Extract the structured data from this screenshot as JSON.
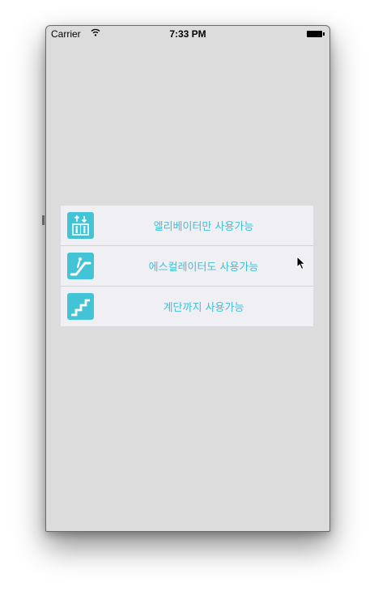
{
  "status_bar": {
    "carrier": "Carrier",
    "time": "7:33 PM",
    "wifi_icon": "wifi-icon",
    "battery_icon": "battery-icon"
  },
  "menu": {
    "items": [
      {
        "label": "엘리베이터만 사용가능",
        "icon": "elevator-icon"
      },
      {
        "label": "에스컬레이터도 사용가능",
        "icon": "escalator-icon"
      },
      {
        "label": "계단까지 사용가능",
        "icon": "stairs-icon"
      }
    ]
  },
  "colors": {
    "accent": "#42c3d6",
    "label": "#3cc0d8",
    "screen_background": "#dcdcdc",
    "menu_background": "#f0f0f4"
  }
}
